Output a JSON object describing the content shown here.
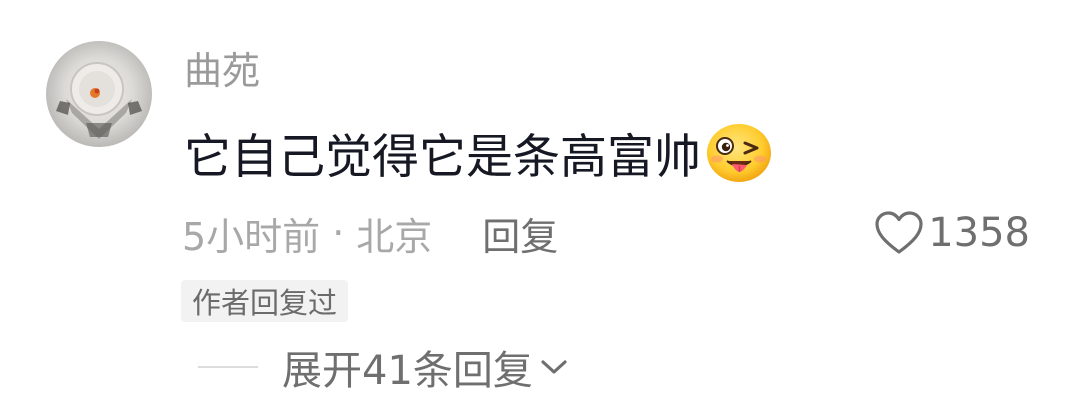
{
  "comment": {
    "username": "曲苑",
    "text": "它自己觉得它是条高富帅",
    "emoji": "grinning-tongue-wink-emoji",
    "time": "5小时前",
    "separator": "·",
    "location": "北京",
    "reply_label": "回复",
    "like_count": "1358",
    "author_badge": "作者回复过",
    "expand_label": "展开41条回复"
  },
  "icons": {
    "like": "heart-outline-icon",
    "expand": "chevron-down-icon"
  },
  "colors": {
    "primary_text": "#161823",
    "secondary_text": "#9a9a9a",
    "badge_background": "#f2f2f3"
  }
}
